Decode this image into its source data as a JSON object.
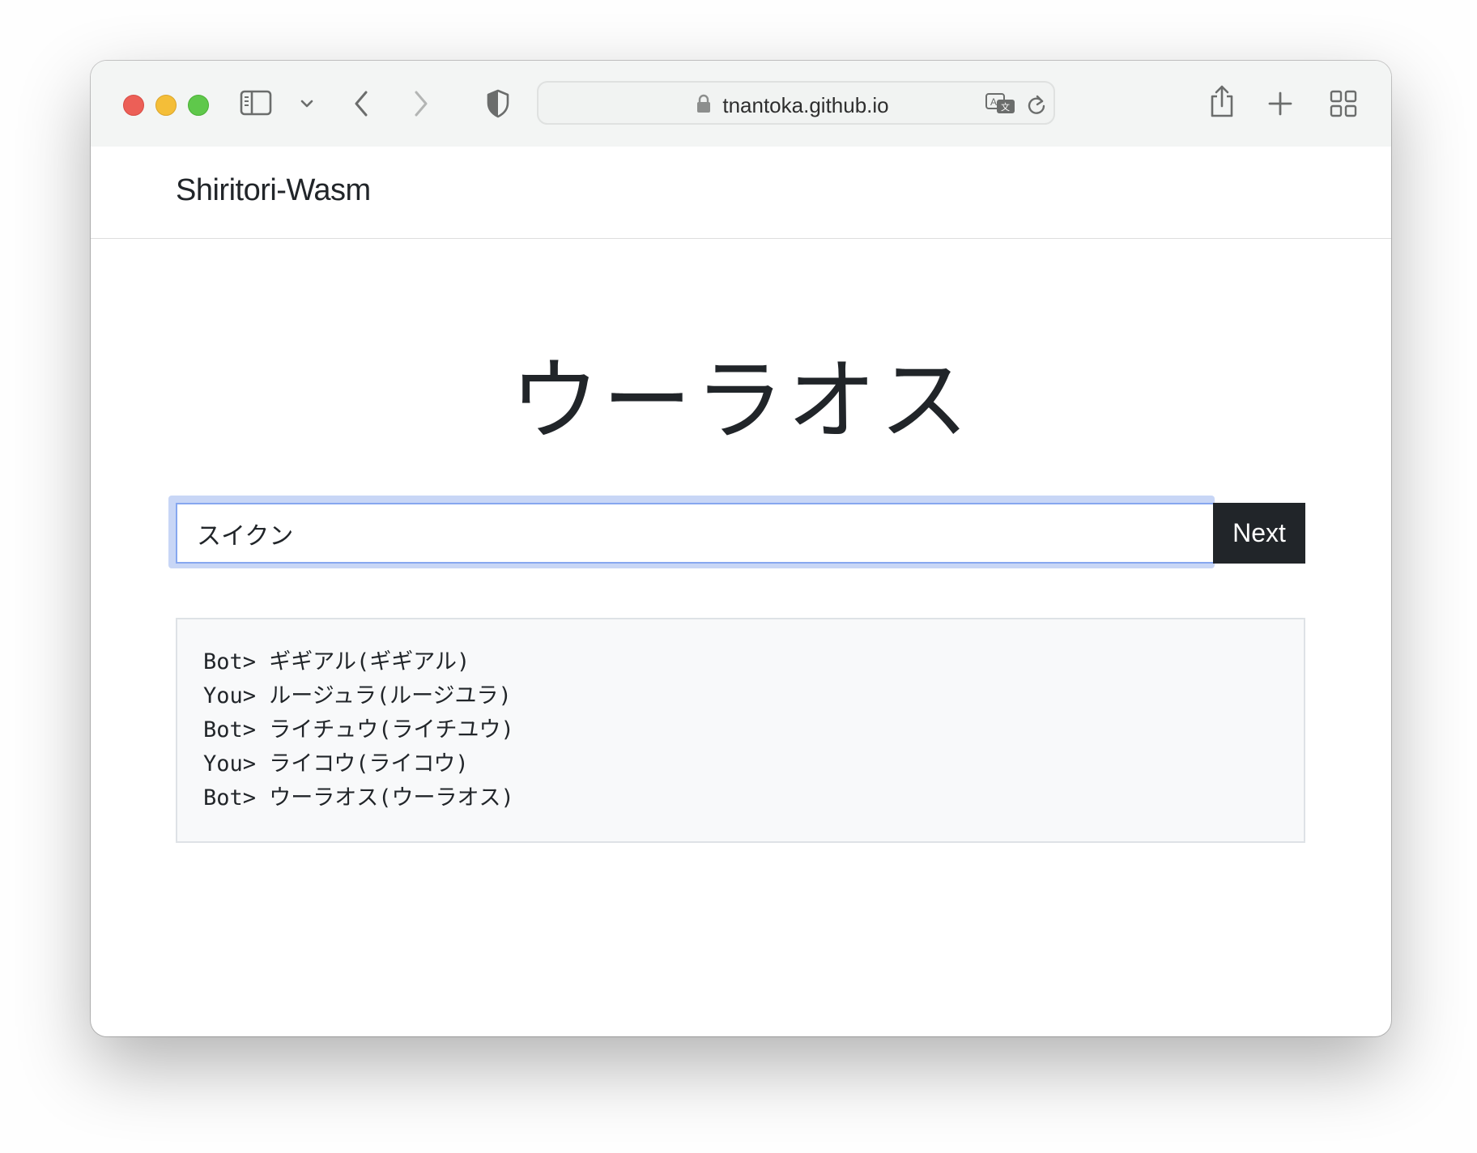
{
  "browser": {
    "url": "tnantoka.github.io",
    "icons": {
      "sidebar": "sidebar-icon",
      "sidebar_menu": "chevron-down-icon",
      "back": "chevron-left-icon",
      "forward": "chevron-right-icon",
      "privacy": "shield-icon",
      "lock": "lock-icon",
      "translate": "translate-icon",
      "reload": "reload-icon",
      "share": "share-icon",
      "new_tab": "plus-icon",
      "tab_overview": "grid-icon"
    }
  },
  "navbar": {
    "brand": "Shiritori-Wasm"
  },
  "game": {
    "current_word": "ウーラオス",
    "input_value": "スイクン",
    "next_label": "Next",
    "log": [
      "Bot> ギギアル(ギギアル)",
      "You> ルージュラ(ルージユラ)",
      "Bot> ライチュウ(ライチユウ)",
      "You> ライコウ(ライコウ)",
      "Bot> ウーラオス(ウーラオス)"
    ]
  },
  "colors": {
    "button_bg": "#212529",
    "focus_ring": "#c8d6f6",
    "log_bg": "#f8f9fa"
  }
}
